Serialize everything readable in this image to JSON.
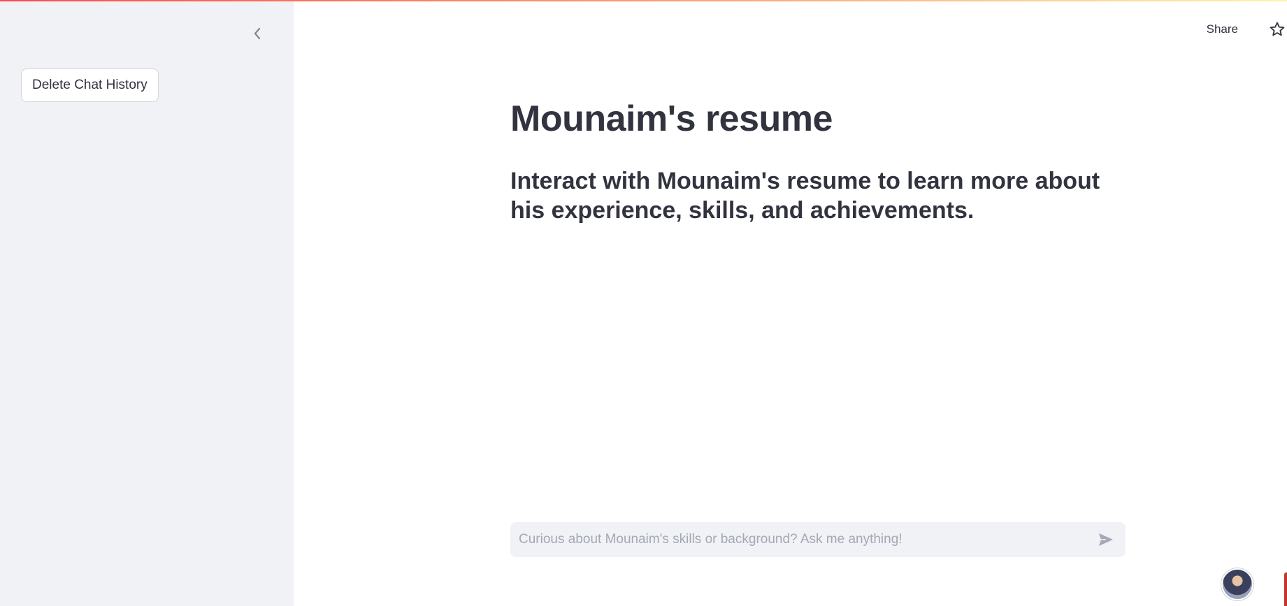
{
  "sidebar": {
    "collapse_icon": "chevron-left-icon",
    "delete_button_label": "Delete Chat History"
  },
  "header": {
    "share_label": "Share",
    "star_icon": "star-icon"
  },
  "main": {
    "title": "Mounaim's resume",
    "subtitle": "Interact with Mounaim's resume to learn more about his experience, skills, and achievements."
  },
  "chat": {
    "placeholder": "Curious about Mounaim's skills or background? Ask me anything!",
    "value": "",
    "send_icon": "send-icon"
  },
  "colors": {
    "sidebar_bg": "#f0f2f6",
    "text": "#31333f",
    "placeholder": "#a3a8b4",
    "accent_red": "#ff4b4b"
  }
}
